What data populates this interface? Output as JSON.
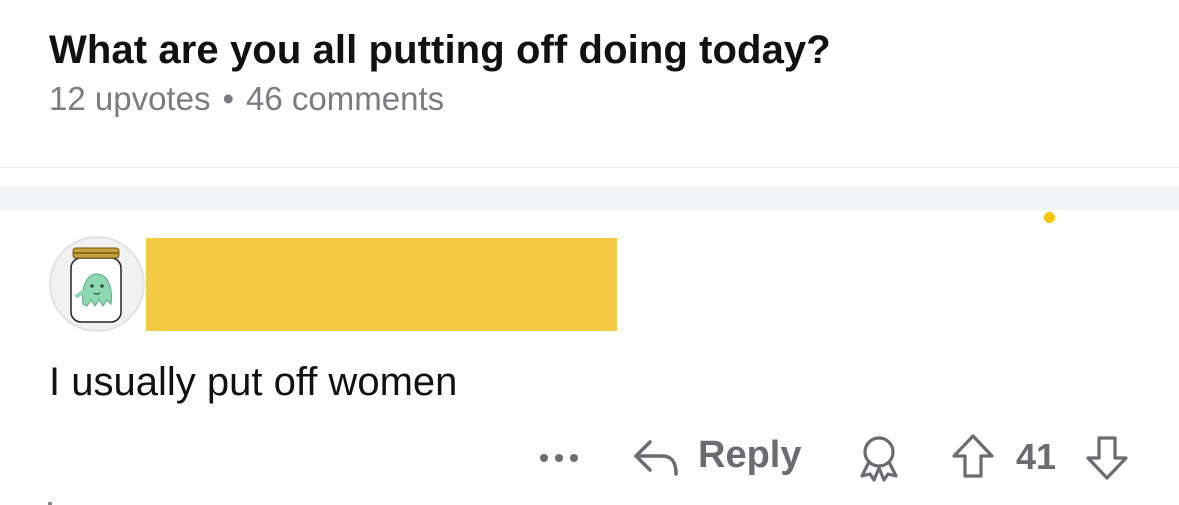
{
  "post": {
    "title": "What are you all putting off doing today?",
    "upvotes": "12 upvotes",
    "separator": "•",
    "comments": "46 comments"
  },
  "comment": {
    "avatar_icon": "ghost-in-jar-icon",
    "username_redacted_color": "#f4ca44",
    "body": "I usually put off women",
    "actions": {
      "more_icon": "more-dots-icon",
      "reply_icon": "reply-arrow-icon",
      "reply_label": "Reply",
      "award_icon": "award-icon",
      "upvote_icon": "upvote-arrow-icon",
      "score": "41",
      "downvote_icon": "downvote-arrow-icon"
    }
  },
  "colors": {
    "new_indicator": "#f5c400",
    "muted_text": "#6b6b70",
    "separator_band": "#f2f3f5"
  }
}
